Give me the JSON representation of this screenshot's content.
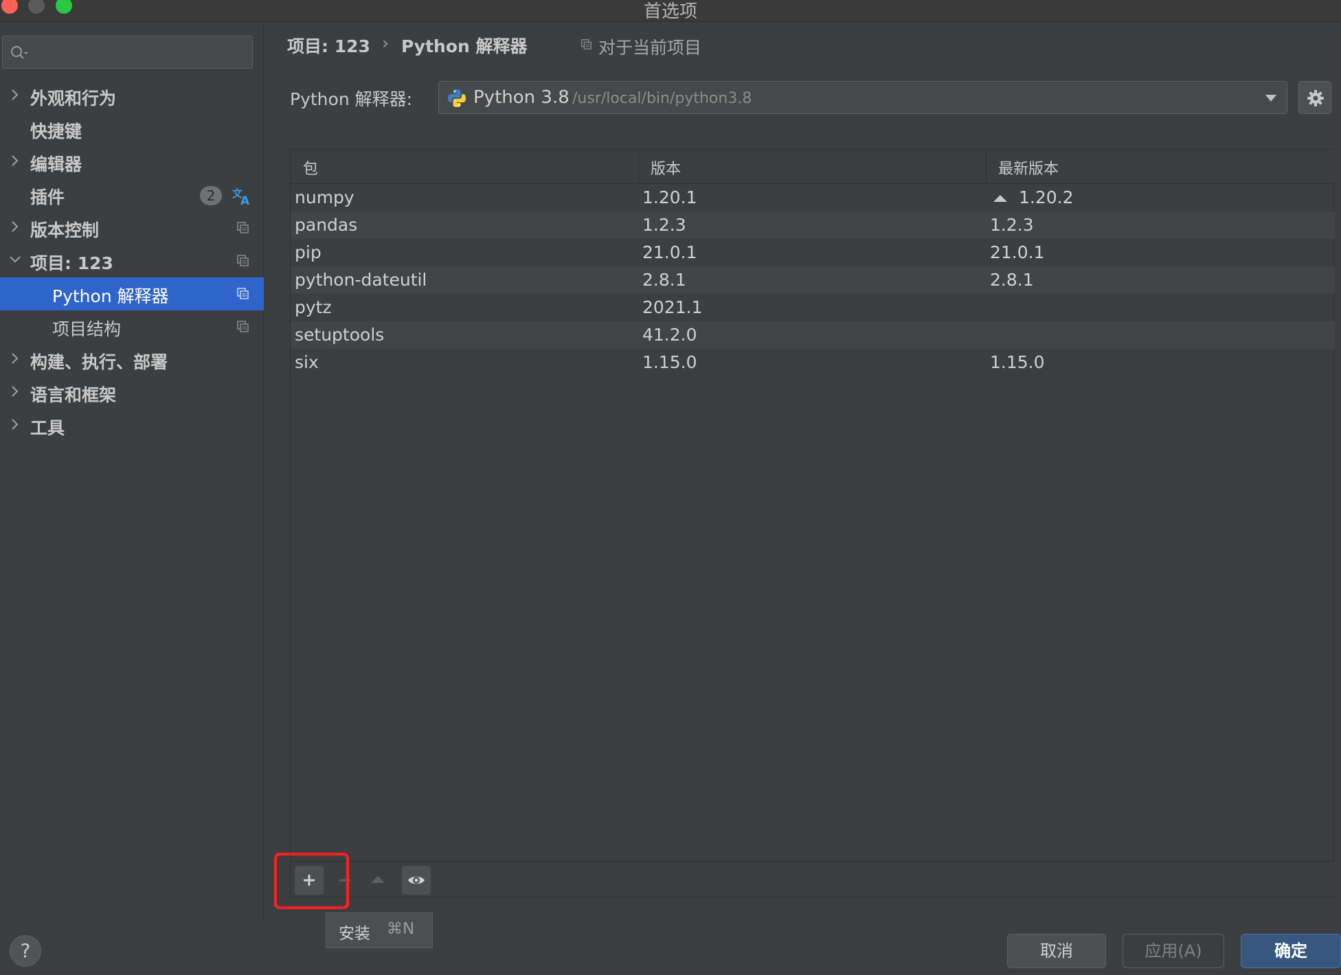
{
  "window": {
    "title": "首选项"
  },
  "sidebar": {
    "search": {
      "placeholder": ""
    },
    "items": [
      {
        "label": "外观和行为",
        "expandable": true,
        "expanded": false
      },
      {
        "label": "快捷键",
        "expandable": false
      },
      {
        "label": "编辑器",
        "expandable": true,
        "expanded": false
      },
      {
        "label": "插件",
        "expandable": false,
        "badge": "2",
        "icon": "translate-icon"
      },
      {
        "label": "版本控制",
        "expandable": true,
        "expanded": false,
        "icon": "project-scope-icon"
      },
      {
        "label": "项目: 123",
        "expandable": true,
        "expanded": true,
        "icon": "project-scope-icon"
      },
      {
        "label": "Python 解释器",
        "selected": true,
        "icon": "project-scope-icon"
      },
      {
        "label": "项目结构",
        "icon": "project-scope-icon"
      },
      {
        "label": "构建、执行、部署",
        "expandable": true,
        "expanded": false
      },
      {
        "label": "语言和框架",
        "expandable": true,
        "expanded": false
      },
      {
        "label": "工具",
        "expandable": true,
        "expanded": false
      }
    ]
  },
  "header": {
    "breadcrumb": [
      "项目: 123",
      "Python 解释器"
    ],
    "breadcrumb_sep": "›",
    "scope_label": "对于当前项目"
  },
  "interpreter": {
    "label": "Python 解释器:",
    "name": "Python 3.8",
    "path": "/usr/local/bin/python3.8"
  },
  "packages": {
    "columns": [
      "包",
      "版本",
      "最新版本"
    ],
    "rows": [
      {
        "package": "numpy",
        "version": "1.20.1",
        "latest": "1.20.2",
        "upgrade": true
      },
      {
        "package": "pandas",
        "version": "1.2.3",
        "latest": "1.2.3",
        "upgrade": false
      },
      {
        "package": "pip",
        "version": "21.0.1",
        "latest": "21.0.1",
        "upgrade": false
      },
      {
        "package": "python-dateutil",
        "version": "2.8.1",
        "latest": "2.8.1",
        "upgrade": false
      },
      {
        "package": "pytz",
        "version": "2021.1",
        "latest": "",
        "upgrade": false
      },
      {
        "package": "setuptools",
        "version": "41.2.0",
        "latest": "",
        "upgrade": false
      },
      {
        "package": "six",
        "version": "1.15.0",
        "latest": "1.15.0",
        "upgrade": false
      }
    ]
  },
  "tooltip": {
    "label": "安装",
    "shortcut": "⌘N"
  },
  "footer": {
    "help_label": "?",
    "cancel_label": "取消",
    "apply_label": "应用(A)",
    "ok_label": "确定"
  },
  "colors": {
    "selection": "#2f65ca",
    "highlight_box": "#ff1f1f",
    "ok_button": "#365880"
  }
}
